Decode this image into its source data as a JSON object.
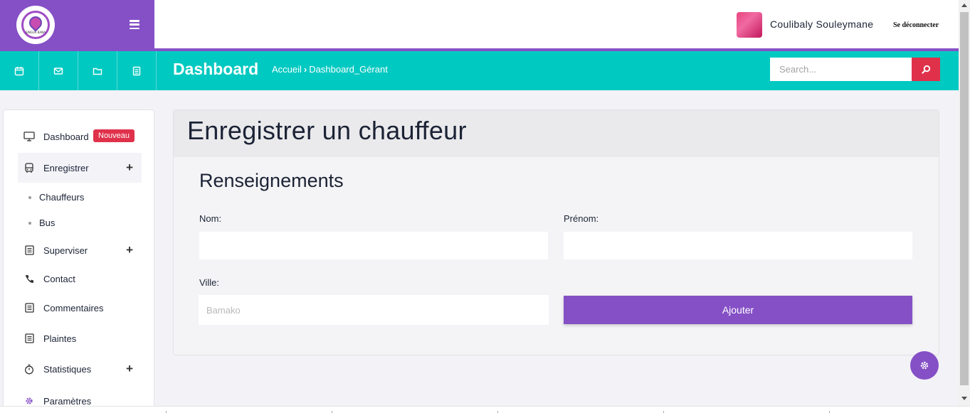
{
  "brand": {
    "logo_text": "SINGUA BANA"
  },
  "header": {
    "user_name": "Coulibaly Souleymane",
    "logout_label": "Se déconnecter"
  },
  "toolbar": {
    "quick_icons": [
      "calendar-icon",
      "mail-icon",
      "folder-icon",
      "document-icon"
    ],
    "page_title": "Dashboard",
    "breadcrumb": {
      "home": "Accueil",
      "separator": "›",
      "current": "Dashboard_Gérant"
    },
    "search": {
      "placeholder": "Search..."
    }
  },
  "sidebar": {
    "items": [
      {
        "label": "Dashboard",
        "icon": "monitor-icon",
        "badge": "Nouveau"
      },
      {
        "label": "Enregistrer",
        "icon": "bus-icon",
        "expand": "+"
      },
      {
        "label": "Chauffeurs"
      },
      {
        "label": "Bus"
      },
      {
        "label": "Superviser",
        "icon": "list-icon",
        "expand": "+"
      },
      {
        "label": "Contact",
        "icon": "phone-icon"
      },
      {
        "label": "Commentaires",
        "icon": "list-icon"
      },
      {
        "label": "Plaintes",
        "icon": "list-icon"
      },
      {
        "label": "Statistiques",
        "icon": "stopwatch-icon",
        "expand": "+"
      },
      {
        "label": "Paramètres",
        "icon": "gear-icon"
      }
    ]
  },
  "form": {
    "title": "Enregistrer un chauffeur",
    "section": "Renseignements",
    "nom_label": "Nom:",
    "nom_value": "",
    "prenom_label": "Prénom:",
    "prenom_value": "",
    "ville_label": "Ville:",
    "ville_placeholder": "Bamako",
    "submit_label": "Ajouter"
  },
  "colors": {
    "primary": "#8550c6",
    "teal": "#00c9c1",
    "danger": "#e0314b"
  }
}
